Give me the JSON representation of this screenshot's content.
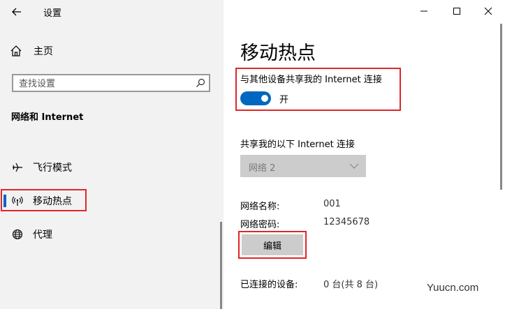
{
  "window": {
    "app_title": "设置",
    "controls": {
      "minimize": "minimize-icon",
      "maximize": "maximize-icon",
      "close": "close-icon"
    }
  },
  "sidebar": {
    "home_label": "主页",
    "search": {
      "placeholder": "查找设置",
      "value": ""
    },
    "section_title": "网络和 Internet",
    "items": [
      {
        "label": "飞行模式",
        "icon": "airplane-icon"
      },
      {
        "label": "移动热点",
        "icon": "hotspot-icon",
        "active": true
      },
      {
        "label": "代理",
        "icon": "globe-icon"
      }
    ]
  },
  "main": {
    "title": "移动热点",
    "share_label": "与其他设备共享我的 Internet 连接",
    "toggle_state": "开",
    "connection_label": "共享我的以下 Internet 连接",
    "connection_value": "网络 2",
    "network_name_label": "网络名称:",
    "network_name_value": "001",
    "network_password_label": "网络密码:",
    "network_password_value": "12345678",
    "edit_button": "编辑",
    "connected_label": "已连接的设备:",
    "connected_value": "0 台(共 8 台)"
  },
  "watermark": "Yuucn.com",
  "colors": {
    "accent": "#0067c0",
    "highlight": "#e0262a",
    "sidebar_bg": "#f2f2f2",
    "disabled_bg": "#cccccc"
  }
}
